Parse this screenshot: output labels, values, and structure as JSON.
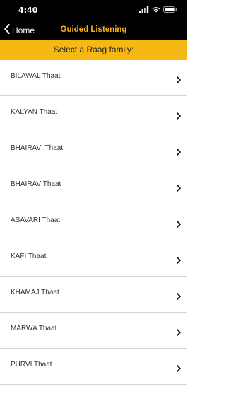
{
  "status_bar": {
    "time": "4:40",
    "icons": [
      "signal-icon",
      "wifi-icon",
      "battery-icon"
    ]
  },
  "nav": {
    "back_label": "Home",
    "title": "Guided Listening"
  },
  "header": {
    "text": "Select a Raag family:"
  },
  "thaats": [
    {
      "label": "BILAWAL Thaat"
    },
    {
      "label": "KALYAN Thaat"
    },
    {
      "label": "BHAIRAVI Thaat"
    },
    {
      "label": "BHAIRAV Thaat"
    },
    {
      "label": "ASAVARI Thaat"
    },
    {
      "label": "KAFI Thaat"
    },
    {
      "label": "KHAMAJ Thaat"
    },
    {
      "label": "MARWA Thaat"
    },
    {
      "label": "PURVI Thaat"
    }
  ],
  "colors": {
    "accent": "#f6b913",
    "nav_title": "#f6b31a",
    "bar_background": "#000000"
  }
}
